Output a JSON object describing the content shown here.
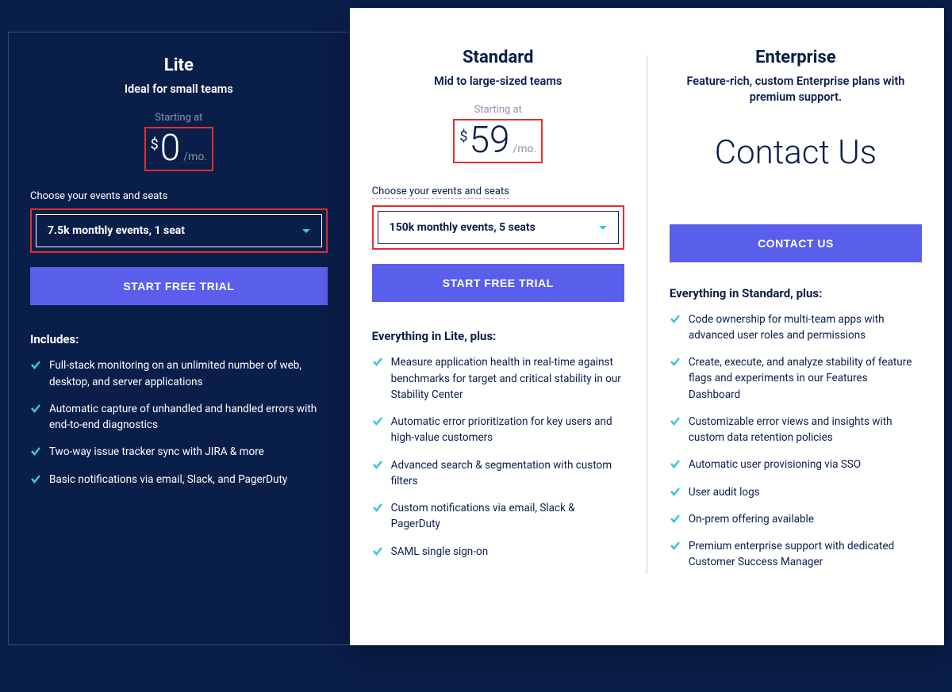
{
  "colors": {
    "bg": "#0a1e4a",
    "accent": "#5a5feb",
    "check": "#3ac7d6",
    "highlight": "#e03030"
  },
  "plans": {
    "lite": {
      "title": "Lite",
      "subtitle": "Ideal for small teams",
      "starting_at": "Starting at",
      "currency": "$",
      "price": "0",
      "suffix": "/mo.",
      "choose_label": "Choose your events and seats",
      "dropdown_value": "7.5k monthly events, 1 seat",
      "cta": "START FREE TRIAL",
      "includes_heading": "Includes:",
      "features": [
        "Full-stack monitoring on an unlimited number of web, desktop, and server applications",
        "Automatic capture of unhandled and handled errors with end-to-end diagnostics",
        "Two-way issue tracker sync with JIRA & more",
        "Basic notifications via email, Slack, and PagerDuty"
      ]
    },
    "standard": {
      "title": "Standard",
      "subtitle": "Mid to large-sized teams",
      "starting_at": "Starting at",
      "currency": "$",
      "price": "59",
      "suffix": "/mo.",
      "choose_label": "Choose your events and seats",
      "dropdown_value": "150k monthly events, 5 seats",
      "cta": "START FREE TRIAL",
      "includes_heading": "Everything in Lite, plus:",
      "features": [
        "Measure application health in real-time against benchmarks for target and critical stability in our Stability Center",
        "Automatic error prioritization for key users and high-value customers",
        "Advanced search & segmentation with custom filters",
        "Custom notifications via email, Slack & PagerDuty",
        "SAML single sign-on"
      ]
    },
    "enterprise": {
      "title": "Enterprise",
      "subtitle": "Feature-rich, custom Enterprise plans with premium support.",
      "contact_big": "Contact Us",
      "cta": "CONTACT US",
      "includes_heading": "Everything in Standard, plus:",
      "features": [
        "Code ownership for multi-team apps with advanced user roles and permissions",
        "Create, execute, and analyze stability of feature flags and experiments in our Features Dashboard",
        "Customizable error views and insights with custom data retention policies",
        "Automatic user provisioning via SSO",
        "User audit logs",
        "On-prem offering available",
        "Premium enterprise support with dedicated Customer Success Manager"
      ]
    }
  }
}
